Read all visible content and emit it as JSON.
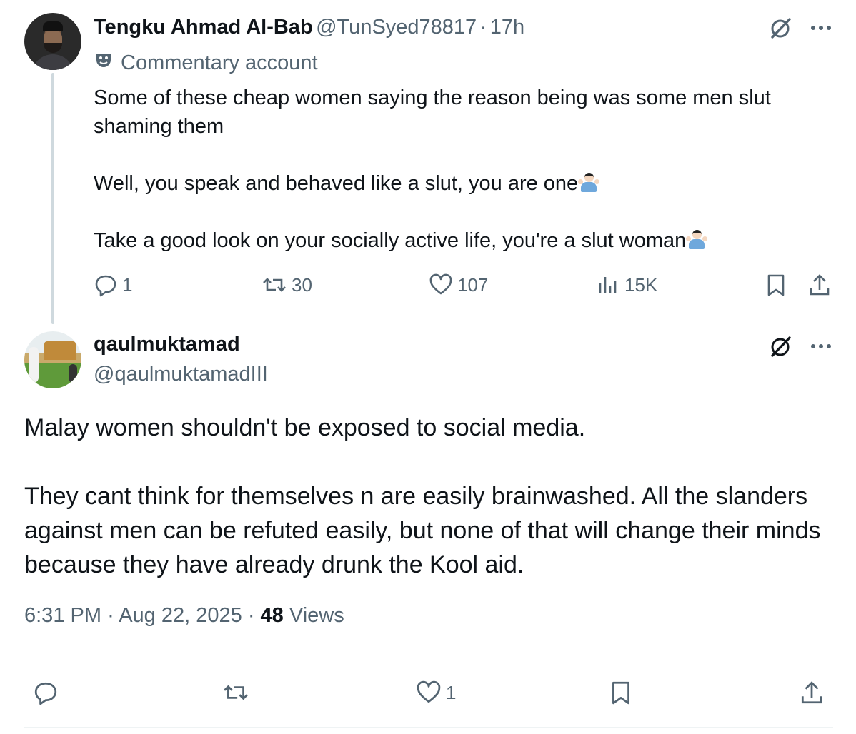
{
  "colors": {
    "text": "#0f1419",
    "muted": "#536471",
    "thread_line": "#cfd9de",
    "divider": "#eff3f4"
  },
  "tweet1": {
    "author_name": "Tengku Ahmad Al-Bab",
    "handle": "@TunSyed78817",
    "separator": "·",
    "time": "17h",
    "label": "Commentary account",
    "paragraphs": [
      "Some of these cheap women saying the reason being was some men slut shaming them",
      "Well, you speak and behaved like a slut,  you are one",
      "Take a good look on your socially active life, you're a slut woman"
    ],
    "stats": {
      "replies": "1",
      "reposts": "30",
      "likes": "107",
      "views": "15K"
    },
    "icons": [
      "grok-icon",
      "more-icon",
      "reply-icon",
      "repost-icon",
      "like-icon",
      "views-icon",
      "bookmark-icon",
      "share-icon"
    ]
  },
  "tweet2": {
    "author_name": "qaulmuktamad",
    "handle": "@qaulmuktamadIII",
    "paragraphs": [
      "Malay women shouldn't be exposed to social media.",
      "They cant think for themselves n are easily brainwashed. All the slanders against men can be refuted easily, but none of that will change their minds because they have already drunk the Kool aid."
    ],
    "time": "6:31 PM",
    "dot": "·",
    "date": "Aug 22, 2025",
    "views_count": "48",
    "views_label": "Views",
    "stats": {
      "likes": "1"
    }
  }
}
